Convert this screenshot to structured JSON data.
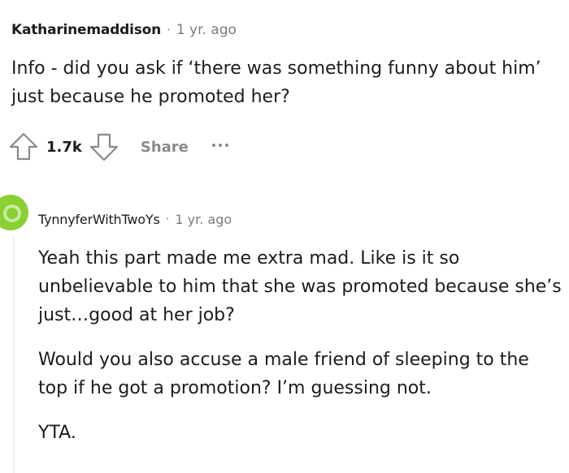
{
  "comment": {
    "author": "Katharinemaddison",
    "separator": "·",
    "time": "1 yr. ago",
    "text": "Info - did you ask if ‘there was something funny about him’ just because he promoted her?",
    "votes": "1.7k",
    "share_label": "Share",
    "icons": {
      "upvote": "arrow-up-outline",
      "downvote": "arrow-down-outline",
      "more": "horizontal-ellipsis"
    }
  },
  "reply": {
    "author": "TynnyferWithTwoYs",
    "separator": "·",
    "time": "1 yr. ago",
    "paragraphs": [
      "Yeah this part made me extra mad. Like is it so unbelievable to him that she was promoted because she’s just…good at her job?",
      "Would you also accuse a male friend of sleeping to the top if he got a promotion? I’m guessing not.",
      "YTA."
    ],
    "avatar_color": "#8bd033"
  },
  "colors": {
    "text": "#1c1c1c",
    "muted": "#878a8c",
    "thread_line": "#edeff1"
  }
}
